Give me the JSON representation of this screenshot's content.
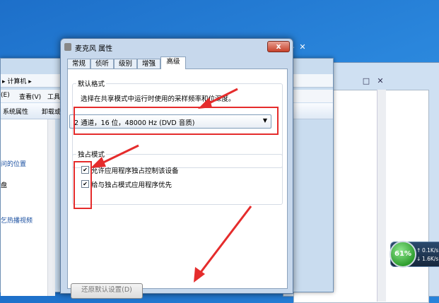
{
  "background_window": {
    "address": "▸ 计算机 ▸",
    "menu_edit": "(E)",
    "menu_view": "查看(V)",
    "menu_tools": "工具",
    "toolbar_sysprops": "系统属性",
    "toolbar_uninstall": "卸载或",
    "left_item_1": "问的位置",
    "left_item_2": "盘",
    "left_item_3": "乞热播视频"
  },
  "dialog": {
    "title": "麦克风 属性",
    "close": "x",
    "tabs": [
      "常规",
      "侦听",
      "级别",
      "增强",
      "高级"
    ],
    "group_default_format": "默认格式",
    "default_format_desc": "选择在共享模式中运行时使用的采样频率和位深度。",
    "format_selected": "2 通道，16 位，48000 Hz (DVD 音质)",
    "group_exclusive": "独占模式",
    "allow_exclusive": "允许应用程序独占控制该设备",
    "priority_exclusive": "给与独占模式应用程序优先",
    "restore_defaults": "还原默认设置(D)"
  },
  "gadget": {
    "percent": "61%",
    "upload": "0.1K/s",
    "download": "1.6K/s"
  },
  "colors": {
    "annotation_red": "#e52c2c",
    "desktop_blue": "#2a86dc"
  }
}
